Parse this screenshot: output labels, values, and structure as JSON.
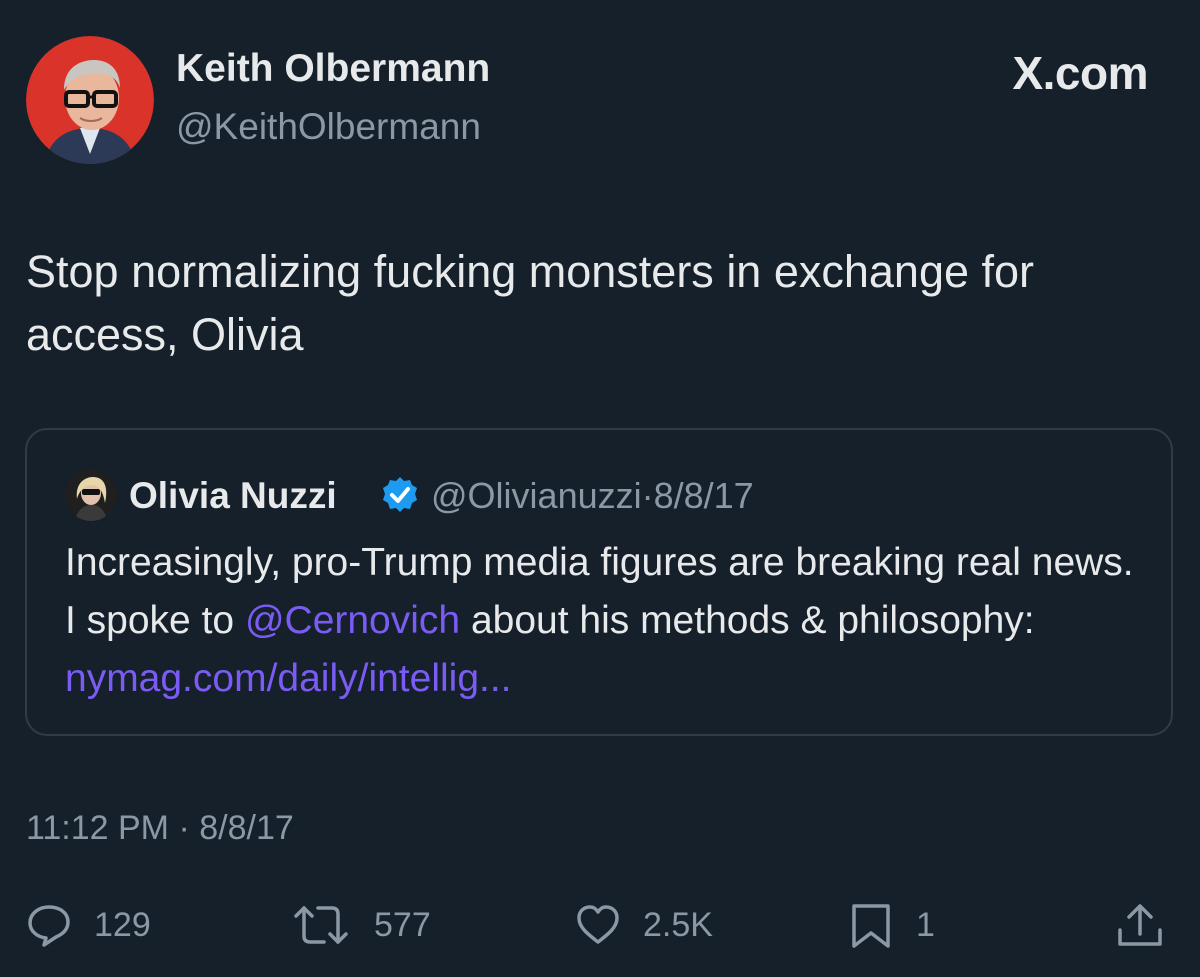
{
  "author": {
    "display_name": "Keith Olbermann",
    "handle": "@KeithOlbermann",
    "avatar_icon": "profile-photo"
  },
  "brand": "X.com",
  "tweet": {
    "text_line1": "Stop normalizing fucking monsters in exchange for",
    "text_line2": "access, Olivia"
  },
  "quoted_tweet": {
    "display_name": "Olivia Nuzzi",
    "verified_icon": "verified-badge-icon",
    "handle": "@Olivianuzzi",
    "separator": "·",
    "date": "8/8/17",
    "text_part1": "Increasingly, pro-Trump media figures are breaking real news. I spoke to ",
    "mention": "@Cernovich",
    "text_part2": " about his methods & philosophy: ",
    "link": "nymag.com/daily/intellig..."
  },
  "timestamp": {
    "time": "11:12 PM",
    "separator": "·",
    "date": "8/8/17"
  },
  "actions": {
    "reply_count": "129",
    "retweet_count": "577",
    "like_count": "2.5K",
    "bookmark_count": "1"
  },
  "colors": {
    "background": "#15202b",
    "text": "#e7e9ea",
    "muted": "#8b98a5",
    "link": "#7a5cf5",
    "verified": "#1d9bf0"
  }
}
